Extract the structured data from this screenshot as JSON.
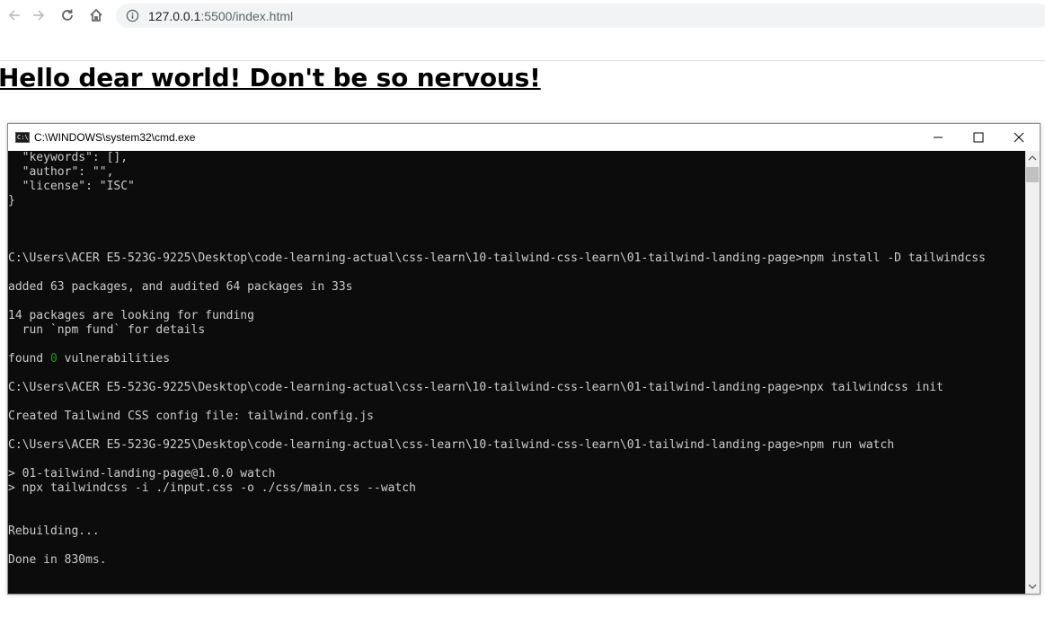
{
  "browser": {
    "url_host": "127.0.0.1",
    "url_rest": ":5500/index.html"
  },
  "page": {
    "heading": "Hello dear world! Don't be so nervous!"
  },
  "cmd": {
    "title": "C:\\WINDOWS\\system32\\cmd.exe",
    "icon_text": "C:\\",
    "lines": [
      "  \"keywords\": [],",
      "  \"author\": \"\",",
      "  \"license\": \"ISC\"",
      "}",
      "",
      "",
      "",
      "C:\\Users\\ACER E5-523G-9225\\Desktop\\code-learning-actual\\css-learn\\10-tailwind-css-learn\\01-tailwind-landing-page>npm install -D tailwindcss",
      "",
      "added 63 packages, and audited 64 packages in 33s",
      "",
      "14 packages are looking for funding",
      "  run `npm fund` for details",
      "",
      "",
      "",
      "C:\\Users\\ACER E5-523G-9225\\Desktop\\code-learning-actual\\css-learn\\10-tailwind-css-learn\\01-tailwind-landing-page>npx tailwindcss init",
      "",
      "Created Tailwind CSS config file: tailwind.config.js",
      "",
      "C:\\Users\\ACER E5-523G-9225\\Desktop\\code-learning-actual\\css-learn\\10-tailwind-css-learn\\01-tailwind-landing-page>npm run watch",
      "",
      "> 01-tailwind-landing-page@1.0.0 watch",
      "> npx tailwindcss -i ./input.css -o ./css/main.css --watch",
      "",
      "",
      "Rebuilding...",
      "",
      "Done in 830ms."
    ],
    "vuln_prefix": "found ",
    "vuln_count": "0",
    "vuln_suffix": " vulnerabilities"
  },
  "icons": {
    "back": "arrow-left-icon",
    "forward": "arrow-right-icon",
    "reload": "reload-icon",
    "home": "home-icon",
    "info": "info-icon",
    "minimize": "minimize-icon",
    "maximize": "maximize-icon",
    "close": "close-icon"
  },
  "colors": {
    "terminal_bg": "#0c0c0c",
    "terminal_fg": "#cccccc",
    "vuln_green": "#13a10e"
  }
}
